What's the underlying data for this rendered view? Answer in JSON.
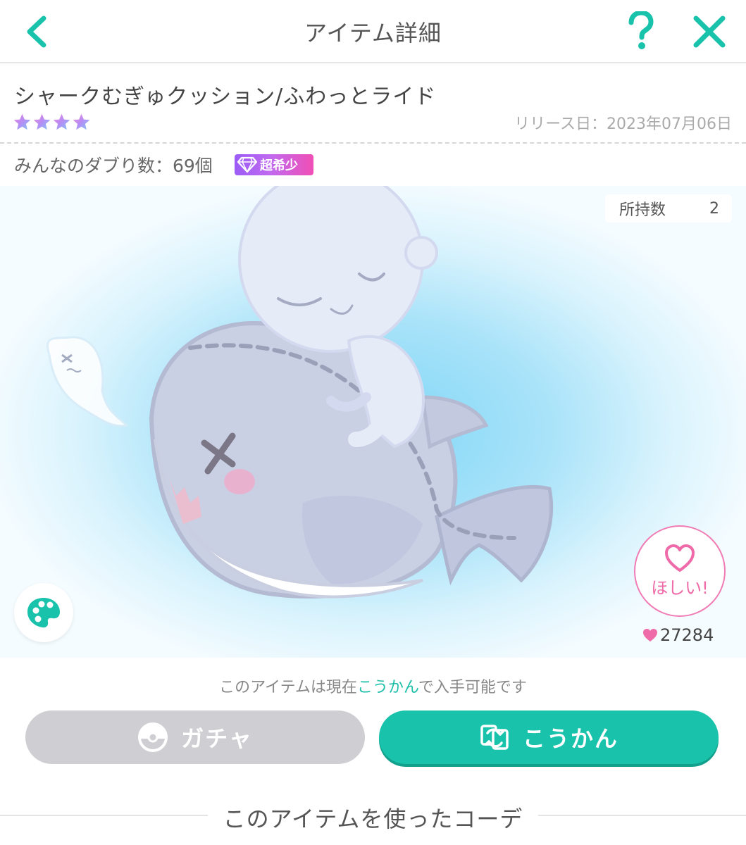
{
  "header": {
    "title": "アイテム詳細",
    "back_icon": "chevron-left-icon",
    "help_label": "?",
    "close_icon": "close-icon",
    "accent_color": "#19c2aa"
  },
  "item": {
    "name": "シャークむぎゅクッション/ふわっとライド",
    "stars": 4,
    "release_label": "リリース日：2023年07月06日",
    "duplicate_label": "みんなのダブり数：69個",
    "rarity_badge": "超希少"
  },
  "stage": {
    "owned_label": "所持数",
    "owned_count": "2",
    "palette_icon": "palette-icon",
    "want_label": "ほしい!",
    "likes_count": "27284"
  },
  "availability": {
    "prefix": "このアイテムは現在",
    "highlight": "こうかん",
    "suffix": "で入手可能です"
  },
  "buttons": {
    "gacha_label": "ガチャ",
    "exchange_label": "こうかん"
  },
  "section": {
    "title": "このアイテムを使ったコーデ"
  }
}
